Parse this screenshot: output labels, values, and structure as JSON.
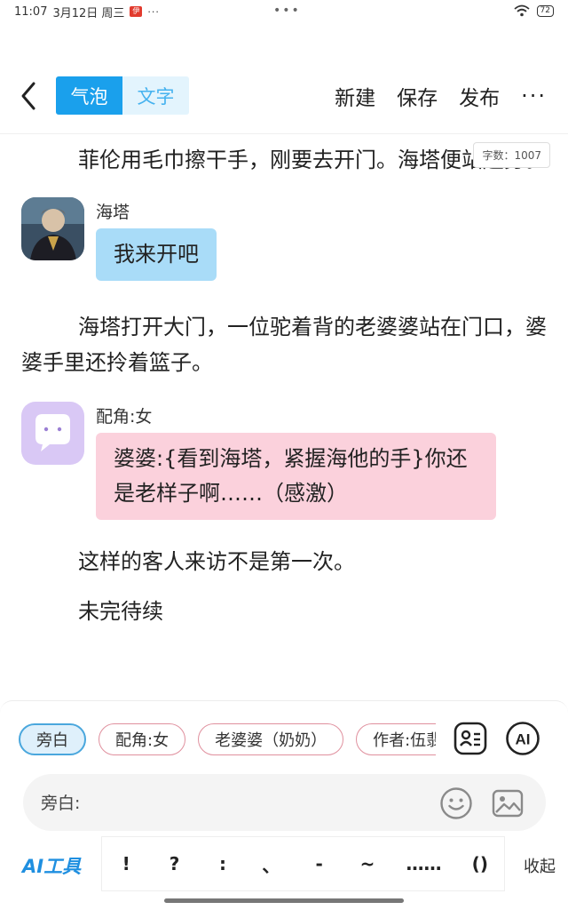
{
  "status_bar": {
    "time": "11:07",
    "date": "3月12日 周三",
    "app_badge": "伊",
    "dots_left": "···",
    "center_dots": "•••",
    "battery": "72"
  },
  "toolbar": {
    "back_icon": "chevron-left-icon",
    "mode_bubble": "气泡",
    "mode_text": "文字",
    "new_label": "新建",
    "save_label": "保存",
    "publish_label": "发布",
    "more_label": "···"
  },
  "word_count": "字数：1007",
  "content": {
    "para1": "菲伦用毛巾擦干手，刚要去开门。海塔便站起身。",
    "msg1": {
      "name": "海塔",
      "text": "我来开吧"
    },
    "para2": "海塔打开大门，一位驼着背的老婆婆站在门口，婆婆手里还拎着篮子。",
    "msg2": {
      "name": "配角:女",
      "text": "婆婆:{看到海塔，紧握海他的手}你还是老样子啊……（感激）"
    },
    "para3": "这样的客人来访不是第一次。",
    "para4": "未完待续"
  },
  "panel": {
    "chips": [
      "旁白",
      "配角:女",
      "老婆婆（奶奶）",
      "作者:伍翡"
    ],
    "input_label": "旁白:",
    "input_value": "",
    "ai_tools": "AI工具",
    "ai_badge": "AI",
    "punctuation": [
      "!",
      "?",
      ":",
      "、",
      "-",
      "~",
      "……",
      "()"
    ],
    "collapse": "收起"
  },
  "colors": {
    "accent": "#1aa0ec",
    "bubble_blue": "#a9dcf8",
    "bubble_pink": "#fbd1dc"
  }
}
